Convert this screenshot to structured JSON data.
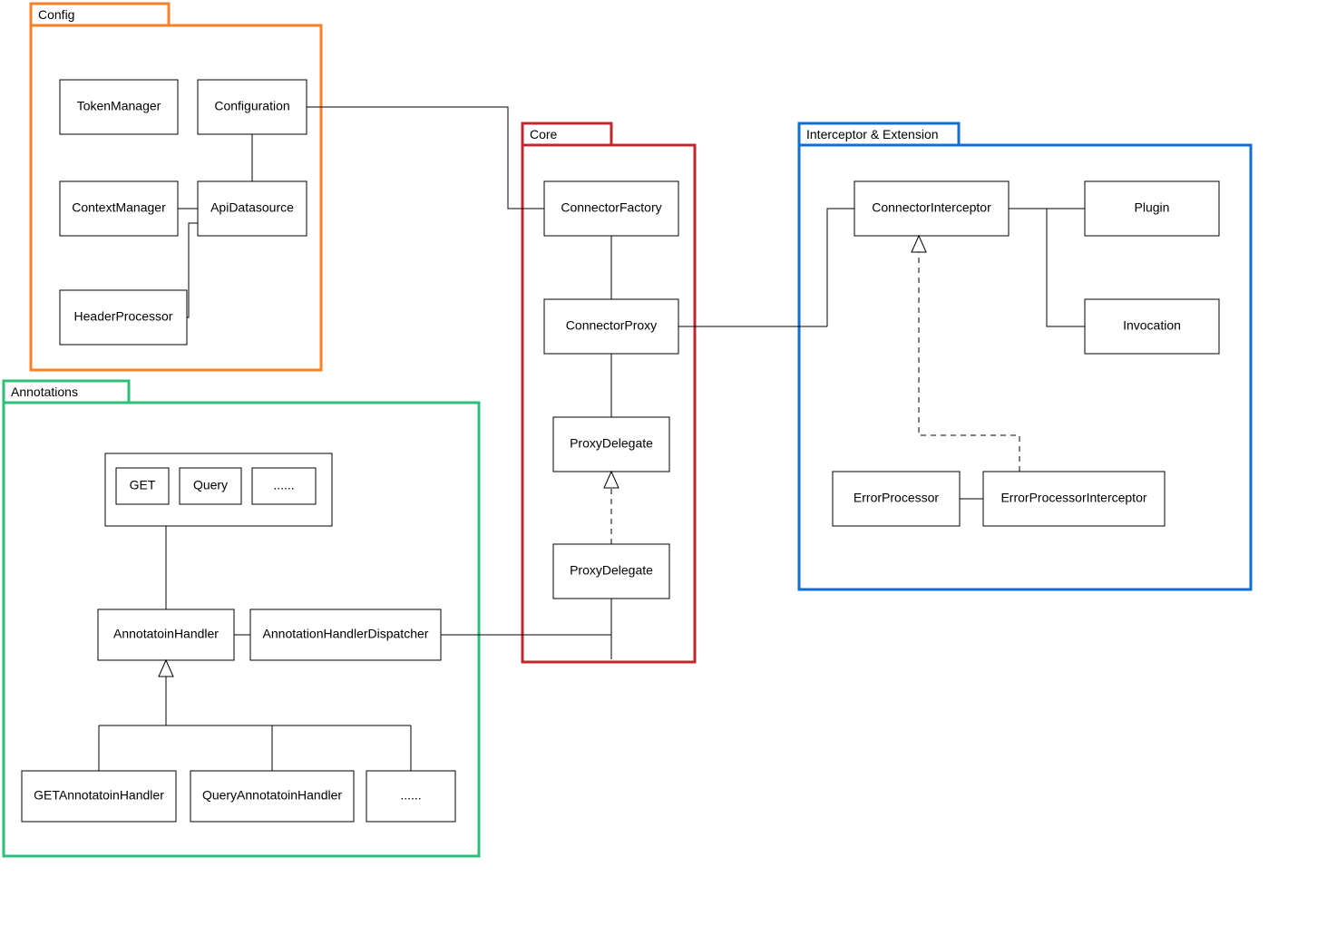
{
  "packages": {
    "config": {
      "label": "Config",
      "color": "#ff7f27"
    },
    "core": {
      "label": "Core",
      "color": "#c1272d"
    },
    "interceptor": {
      "label": "Interceptor & Extension",
      "color": "#0f6fd6"
    },
    "annotations": {
      "label": "Annotations",
      "color": "#2dbf78"
    }
  },
  "config": {
    "tokenManager": "TokenManager",
    "configuration": "Configuration",
    "contextManager": "ContextManager",
    "apiDatasource": "ApiDatasource",
    "headerProcessor": "HeaderProcessor"
  },
  "core": {
    "connectorFactory": "ConnectorFactory",
    "connectorProxy": "ConnectorProxy",
    "proxyDelegate1": "ProxyDelegate",
    "proxyDelegate2": "ProxyDelegate"
  },
  "interceptor": {
    "connectorInterceptor": "ConnectorInterceptor",
    "plugin": "Plugin",
    "invocation": "Invocation",
    "errorProcessor": "ErrorProcessor",
    "errorProcessorInterceptor": "ErrorProcessorInterceptor"
  },
  "annotations": {
    "get": "GET",
    "query": "Query",
    "more": "......",
    "annotationHandler": "AnnotatoinHandler",
    "annotationHandlerDispatcher": "AnnotationHandlerDispatcher",
    "getAnnotationHandler": "GETAnnotatoinHandler",
    "queryAnnotationHandler": "QueryAnnotatoinHandler",
    "moreHandlers": "......"
  }
}
